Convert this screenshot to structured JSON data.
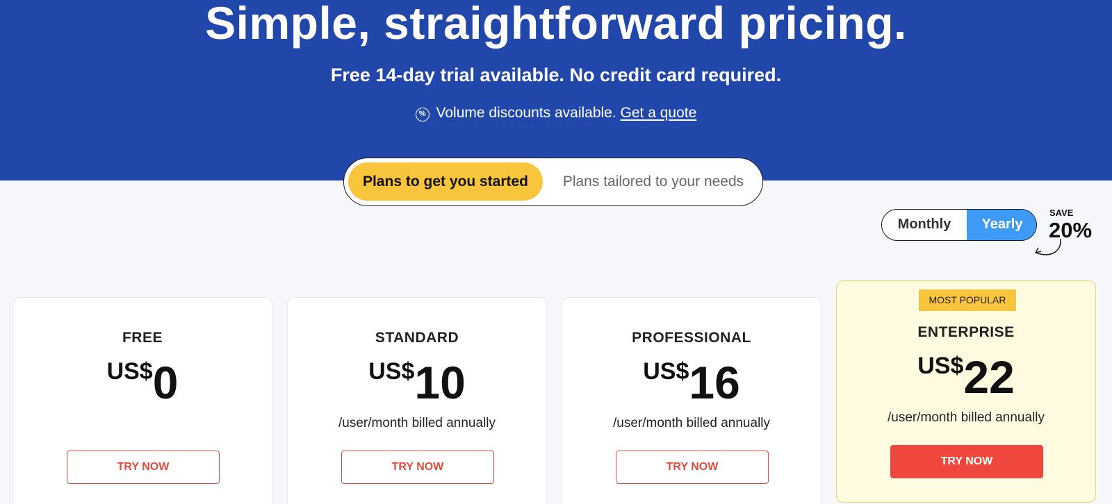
{
  "hero": {
    "title": "Simple, straightforward pricing.",
    "subtitle": "Free 14-day trial available. No credit card required.",
    "discount_text": "Volume discounts available.",
    "quote_link": "Get a quote",
    "discount_icon": "percent-icon",
    "background": "#2247ab"
  },
  "plan_switch": {
    "active_label": "Plans to get you started",
    "inactive_label": "Plans tailored to your needs"
  },
  "billing": {
    "monthly_label": "Monthly",
    "yearly_label": "Yearly",
    "selected": "Yearly",
    "save_label": "SAVE",
    "save_value": "20%"
  },
  "plans": [
    {
      "name": "FREE",
      "currency": "US$",
      "price": "0",
      "billed": "",
      "cta": "TRY NOW"
    },
    {
      "name": "STANDARD",
      "currency": "US$",
      "price": "10",
      "billed": "/user/month billed annually",
      "cta": "TRY NOW"
    },
    {
      "name": "PROFESSIONAL",
      "currency": "US$",
      "price": "16",
      "billed": "/user/month billed annually",
      "cta": "TRY NOW"
    },
    {
      "name": "ENTERPRISE",
      "badge": "MOST POPULAR",
      "currency": "US$",
      "price": "22",
      "billed": "/user/month billed annually",
      "cta": "TRY NOW"
    }
  ],
  "colors": {
    "accent_yellow": "#f8c53c",
    "toggle_blue": "#3d9bf5",
    "cta_red": "#ef473d"
  }
}
